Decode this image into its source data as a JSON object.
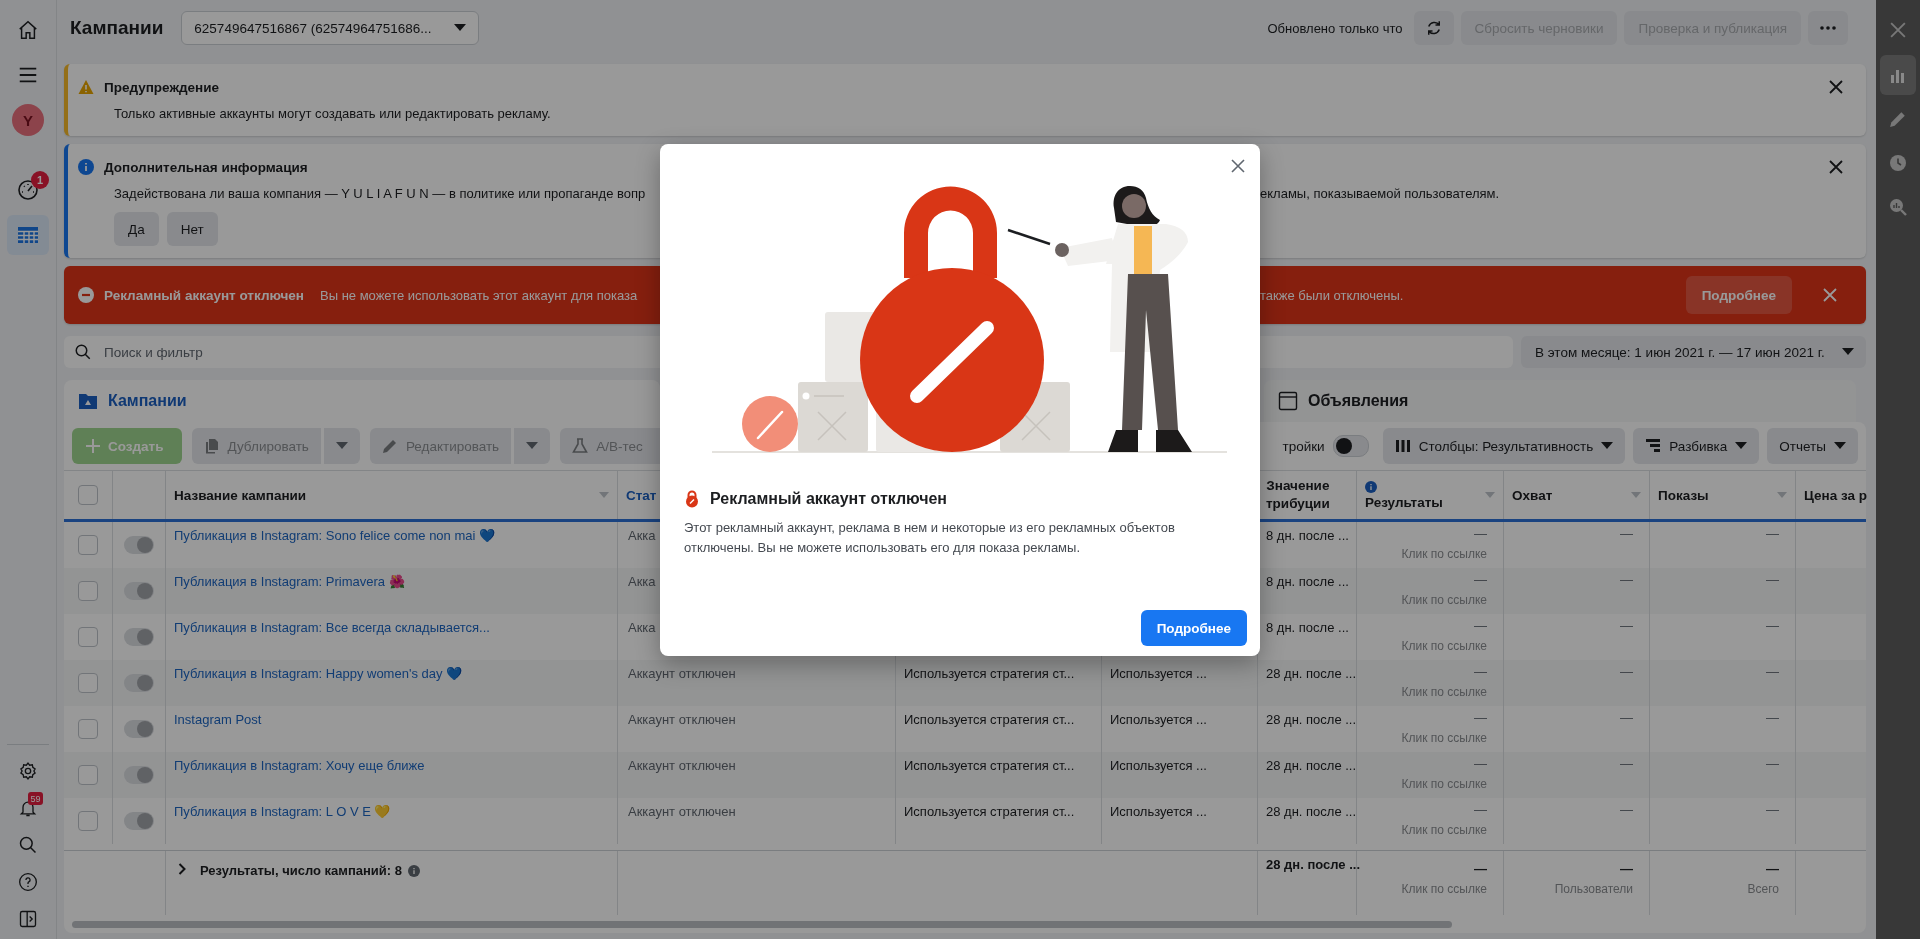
{
  "left_nav": {
    "items": [
      {
        "kind": "home",
        "selected": false
      },
      {
        "kind": "menu",
        "selected": false
      },
      {
        "kind": "avatar",
        "letter": "Y",
        "selected": false
      },
      {
        "kind": "gauge",
        "badge": "1",
        "selected": false
      },
      {
        "kind": "table",
        "selected": true
      }
    ],
    "bottom_items": [
      {
        "kind": "gear"
      },
      {
        "kind": "bell",
        "badge": "59"
      },
      {
        "kind": "search"
      },
      {
        "kind": "help"
      },
      {
        "kind": "panel"
      }
    ]
  },
  "header": {
    "title": "Кампании",
    "account": "625749647516867 (62574964751686...",
    "updated": "Обновлено только что",
    "buttons": [
      {
        "label": "Сбросить черновики",
        "disabled": true
      },
      {
        "label": "Проверка и публикация",
        "disabled": true
      }
    ]
  },
  "banners": [
    {
      "kind": "warning",
      "title": "Предупреждение",
      "text": "Только активные аккаунты могут создавать или редактировать рекламу."
    },
    {
      "kind": "info",
      "title": "Дополнительная информация",
      "text": "Задействована ли ваша компания — Y U L I A F U N — в политике или пропаганде вопр",
      "text_after": "екламы, показываемой пользователям.",
      "buttons": [
        "Да",
        "Нет"
      ]
    },
    {
      "kind": "error",
      "title": "Рекламный аккаунт отключен",
      "text": "Вы не можете использовать этот аккаунт для показа",
      "text_after": "также были отключены.",
      "action": "Подробнее"
    }
  ],
  "search": {
    "placeholder": "Поиск и фильтр"
  },
  "date_range": "В этом месяце: 1 июн 2021 г. — 17 июн 2021 г.",
  "tabs": [
    {
      "kind": "campaigns",
      "label": "Кампании",
      "selected": true
    },
    {
      "kind": "ads",
      "label": "Объявления",
      "selected": false
    }
  ],
  "toolbar": {
    "buttons": [
      {
        "kind": "create",
        "label": "Создать",
        "has_menu": false
      },
      {
        "kind": "duplicate",
        "label": "Дублировать",
        "has_menu": true
      },
      {
        "kind": "edit",
        "label": "Редактировать",
        "has_menu": true
      },
      {
        "kind": "abtest",
        "label": "A/B-тес",
        "has_menu": false
      }
    ],
    "setting_label": "тройки",
    "setting_on": false,
    "views": [
      {
        "kind": "columns",
        "label": "Столбцы: Результативность"
      },
      {
        "kind": "breakdown",
        "label": "Разбивка"
      },
      {
        "kind": "reports",
        "label": "Отчеты"
      }
    ]
  },
  "table": {
    "all_checked": false,
    "headers": {
      "name": "Название кампании",
      "status": "Стат",
      "attribution": "Значение\nтрибуции",
      "results": "Результаты",
      "reach": "Охват",
      "impressions": "Показы",
      "price": "Цена за р"
    },
    "rows": [
      {
        "checked": false,
        "on": true,
        "name": "Публикация в Instagram: Sono felice come non mai 💙",
        "status": "Акка",
        "attribution": "8 дн. после ...",
        "result": "—",
        "result_type": "Клик по ссылке",
        "reach": "—",
        "impressions": "—"
      },
      {
        "checked": false,
        "on": true,
        "name": "Публикация в Instagram: Primavera 🌺",
        "status": "Акка",
        "attribution": "8 дн. после ...",
        "result": "—",
        "result_type": "Клик по ссылке",
        "reach": "—",
        "impressions": "—"
      },
      {
        "checked": false,
        "on": true,
        "name": "Публикация в Instagram: Все всегда складывается...",
        "status": "Акка",
        "attribution": "8 дн. после ...",
        "result": "—",
        "result_type": "Клик по ссылке",
        "reach": "—",
        "impressions": "—"
      },
      {
        "checked": false,
        "on": true,
        "name": "Публикация в Instagram: Happy women's day 💙",
        "status": "Аккаунт отключен",
        "bid": "Используется стратегия ст...",
        "budget": "Используется ...",
        "attribution": "28 дн. после ...",
        "result": "—",
        "result_type": "Клик по ссылке",
        "reach": "—",
        "impressions": "—"
      },
      {
        "checked": false,
        "on": true,
        "name": "Instagram Post",
        "status": "Аккаунт отключен",
        "bid": "Используется стратегия ст...",
        "budget": "Используется ...",
        "attribution": "28 дн. после ...",
        "result": "—",
        "result_type": "Клик по ссылке",
        "reach": "—",
        "impressions": "—"
      },
      {
        "checked": false,
        "on": true,
        "name": "Публикация в Instagram: Хочу еще ближе",
        "status": "Аккаунт отключен",
        "bid": "Используется стратегия ст...",
        "budget": "Используется ...",
        "attribution": "28 дн. после ...",
        "result": "—",
        "result_type": "Клик по ссылке",
        "reach": "—",
        "impressions": "—"
      },
      {
        "checked": false,
        "on": true,
        "name": "Публикация в Instagram: L O V E 💛",
        "status": "Аккаунт отключен",
        "bid": "Используется стратегия ст...",
        "budget": "Используется ...",
        "attribution": "28 дн. после ...",
        "result": "—",
        "result_type": "Клик по ссылке",
        "reach": "—",
        "impressions": "—"
      }
    ],
    "footer": {
      "label": "Результаты, число кампаний: 8",
      "attribution": "28 дн. после ...",
      "totals": [
        {
          "value": "—",
          "caption": "Клик по ссылке"
        },
        {
          "value": "—",
          "caption": "Пользователи"
        },
        {
          "value": "—",
          "caption": "Всего"
        }
      ]
    }
  },
  "right_panel": {
    "items": [
      {
        "kind": "close",
        "selected": false
      },
      {
        "kind": "chart",
        "selected": true
      },
      {
        "kind": "pencil",
        "selected": false
      },
      {
        "kind": "clock",
        "selected": false
      },
      {
        "kind": "zoom-chart",
        "selected": false
      }
    ]
  },
  "modal": {
    "title": "Рекламный аккаунт отключен",
    "text": "Этот рекламный аккаунт, реклама в нем и некоторые из его рекламных объектов отключены. Вы не можете использовать его для показа рекламы.",
    "button": "Подробнее"
  }
}
